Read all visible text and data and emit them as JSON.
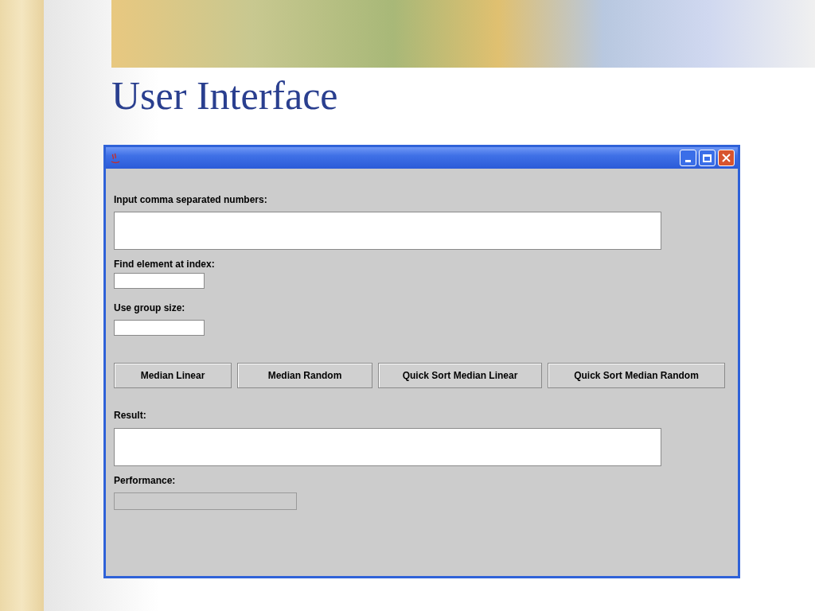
{
  "slide": {
    "title": "User Interface"
  },
  "window": {
    "number_input": {
      "label": "Input comma separated numbers:"
    },
    "index_input": {
      "label": "Find element at index:"
    },
    "group_input": {
      "label": "Use group size:"
    },
    "buttons": [
      "Median Linear",
      "Median Random",
      "Quick Sort Median Linear",
      "Quick Sort Median Random"
    ],
    "result": {
      "label": "Result:"
    },
    "performance": {
      "label": "Performance:",
      "disabled": true
    }
  }
}
